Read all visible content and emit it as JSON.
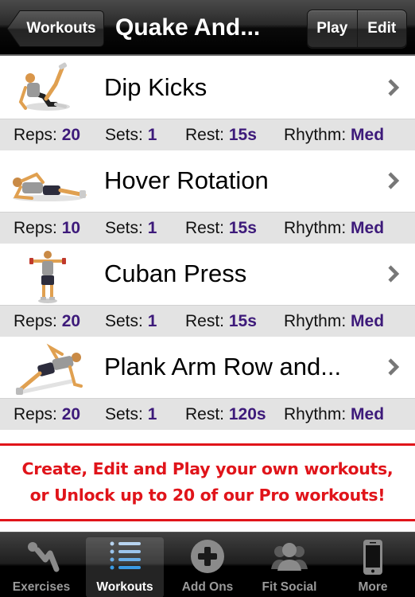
{
  "navbar": {
    "back_label": "Workouts",
    "title": "Quake And...",
    "play_label": "Play",
    "edit_label": "Edit"
  },
  "stat_labels": {
    "reps": "Reps:",
    "sets": "Sets:",
    "rest": "Rest:",
    "rhythm": "Rhythm:"
  },
  "exercises": [
    {
      "name": "Dip Kicks",
      "icon": "dip-kicks-figure",
      "reps": "20",
      "sets": "1",
      "rest": "15s",
      "rhythm": "Med"
    },
    {
      "name": "Hover Rotation",
      "icon": "side-plank-figure",
      "reps": "10",
      "sets": "1",
      "rest": "15s",
      "rhythm": "Med"
    },
    {
      "name": "Cuban Press",
      "icon": "standing-dumbbell-figure",
      "reps": "20",
      "sets": "1",
      "rest": "15s",
      "rhythm": "Med"
    },
    {
      "name": "Plank Arm Row and...",
      "icon": "plank-row-figure",
      "reps": "20",
      "sets": "1",
      "rest": "120s",
      "rhythm": "Med"
    }
  ],
  "promo": {
    "line1": "Create, Edit and Play your own workouts,",
    "line2": "or Unlock up to 20 of our Pro workouts!"
  },
  "tabs": [
    {
      "label": "Exercises",
      "icon": "situp-figure-icon",
      "active": false
    },
    {
      "label": "Workouts",
      "icon": "list-icon",
      "active": true
    },
    {
      "label": "Add Ons",
      "icon": "plus-circle-icon",
      "active": false
    },
    {
      "label": "Fit Social",
      "icon": "people-icon",
      "active": false
    },
    {
      "label": "More",
      "icon": "phone-icon",
      "active": false
    }
  ],
  "colors": {
    "stat_value": "#3d1a7a",
    "promo_red": "#e0141a",
    "stats_band": "#e3e3e3",
    "tab_active_label": "#ffffff",
    "tab_inactive_label": "#9a9a9a"
  }
}
